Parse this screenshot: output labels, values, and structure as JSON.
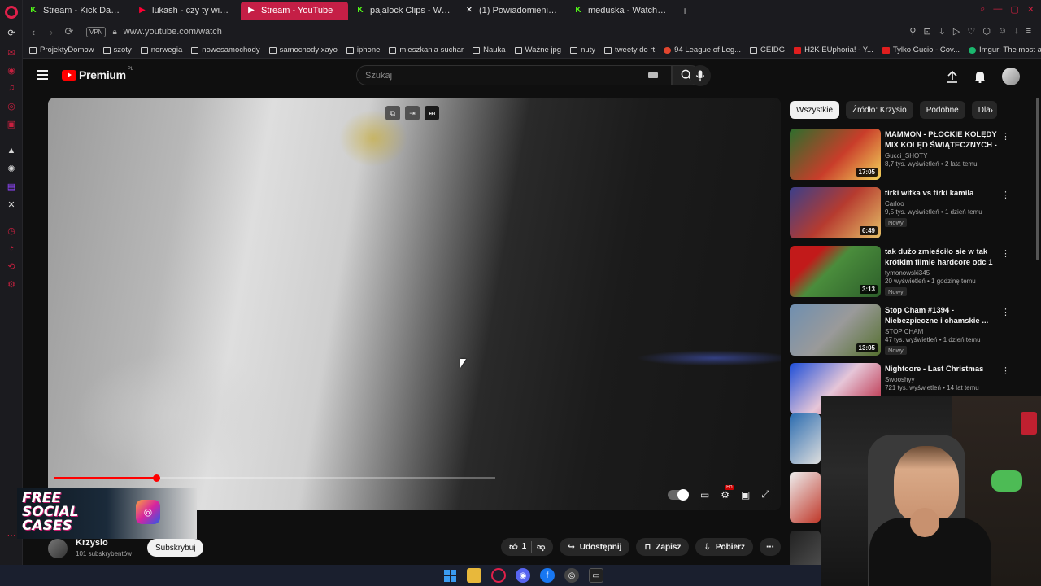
{
  "browser": {
    "tabs": [
      {
        "label": "Stream - Kick Dashboard",
        "icon": "kick-icon",
        "active": false
      },
      {
        "label": "lukash - czy ty wiesz spe",
        "icon": "youtube-icon",
        "active": false
      },
      {
        "label": "Stream - YouTube",
        "icon": "youtube-icon",
        "active": true
      },
      {
        "label": "pajalock Clips - Watch Li",
        "icon": "kick-icon",
        "active": false
      },
      {
        "label": "(1) Powiadomienia / X",
        "icon": "x-icon",
        "active": false
      },
      {
        "label": "meduska - Watch clips on",
        "icon": "kick-icon",
        "active": false
      }
    ],
    "vpn_label": "VPN",
    "url": "www.youtube.com/watch",
    "bookmarks": [
      {
        "label": "ProjektyDomow",
        "icon": "folder"
      },
      {
        "label": "szoty",
        "icon": "folder"
      },
      {
        "label": "norwegia",
        "icon": "folder"
      },
      {
        "label": "nowesamochody",
        "icon": "folder"
      },
      {
        "label": "samochody xayo",
        "icon": "folder"
      },
      {
        "label": "iphone",
        "icon": "folder"
      },
      {
        "label": "mieszkania suchar",
        "icon": "folder"
      },
      {
        "label": "Nauka",
        "icon": "folder"
      },
      {
        "label": "Ważne jpg",
        "icon": "folder"
      },
      {
        "label": "nuty",
        "icon": "folder"
      },
      {
        "label": "tweety do rt",
        "icon": "folder"
      },
      {
        "label": "94 League of Leg...",
        "icon": "site"
      },
      {
        "label": "CEIDG",
        "icon": "folder"
      },
      {
        "label": "H2K EUphoria! - Y...",
        "icon": "youtube"
      },
      {
        "label": "Tylko Gucio - Cov...",
        "icon": "youtube"
      },
      {
        "label": "Imgur: The most a...",
        "icon": "site"
      }
    ]
  },
  "youtube": {
    "logo_text": "Premium",
    "region": "PL",
    "search_placeholder": "Szukaj",
    "progress_fraction": 0.23,
    "channel": {
      "name": "Krzysio",
      "subs": "101 subskrybentów",
      "subscribe_label": "Subskrybuj"
    },
    "actions": {
      "likes": "1",
      "share": "Udostępnij",
      "save": "Zapisz",
      "download": "Pobierz"
    },
    "ad_text": "FREE SOCIAL CASES",
    "chips": [
      "Wszystkie",
      "Źródło: Krzysio",
      "Podobne",
      "Dla"
    ],
    "recommendations": [
      {
        "title": "MAMMON - PŁOCKIE KOLĘDY MIX KOLĘD ŚWIĄTECZNYCH - ...",
        "channel": "Gucci_SHOTY",
        "meta": "8,7 tys. wyświetleń • 2 lata temu",
        "duration": "17:05",
        "badge": ""
      },
      {
        "title": "tirki witka vs tirki kamila",
        "channel": "Carloo",
        "meta": "9,5 tys. wyświetleń • 1 dzień temu",
        "duration": "6:49",
        "badge": "Nowy"
      },
      {
        "title": "tak dużo zmieściło sie w tak krótkim filmie hardcore odc 1",
        "channel": "tymonowski345",
        "meta": "20 wyświetleń • 1 godzinę temu",
        "duration": "3:13",
        "badge": "Nowy"
      },
      {
        "title": "Stop Cham #1394 - Niebezpieczne i chamskie ...",
        "channel": "STOP CHAM",
        "meta": "47 tys. wyświetleń • 1 dzień temu",
        "duration": "13:05",
        "badge": "Nowy"
      },
      {
        "title": "Nightcore - Last Christmas",
        "channel": "Swooshyy",
        "meta": "721 tys. wyświetleń • 14 lat temu",
        "duration": "",
        "badge": ""
      }
    ]
  },
  "colors": {
    "accent": "#c51f46",
    "yt_red": "#ff0000",
    "background": "#0f0f0f"
  }
}
